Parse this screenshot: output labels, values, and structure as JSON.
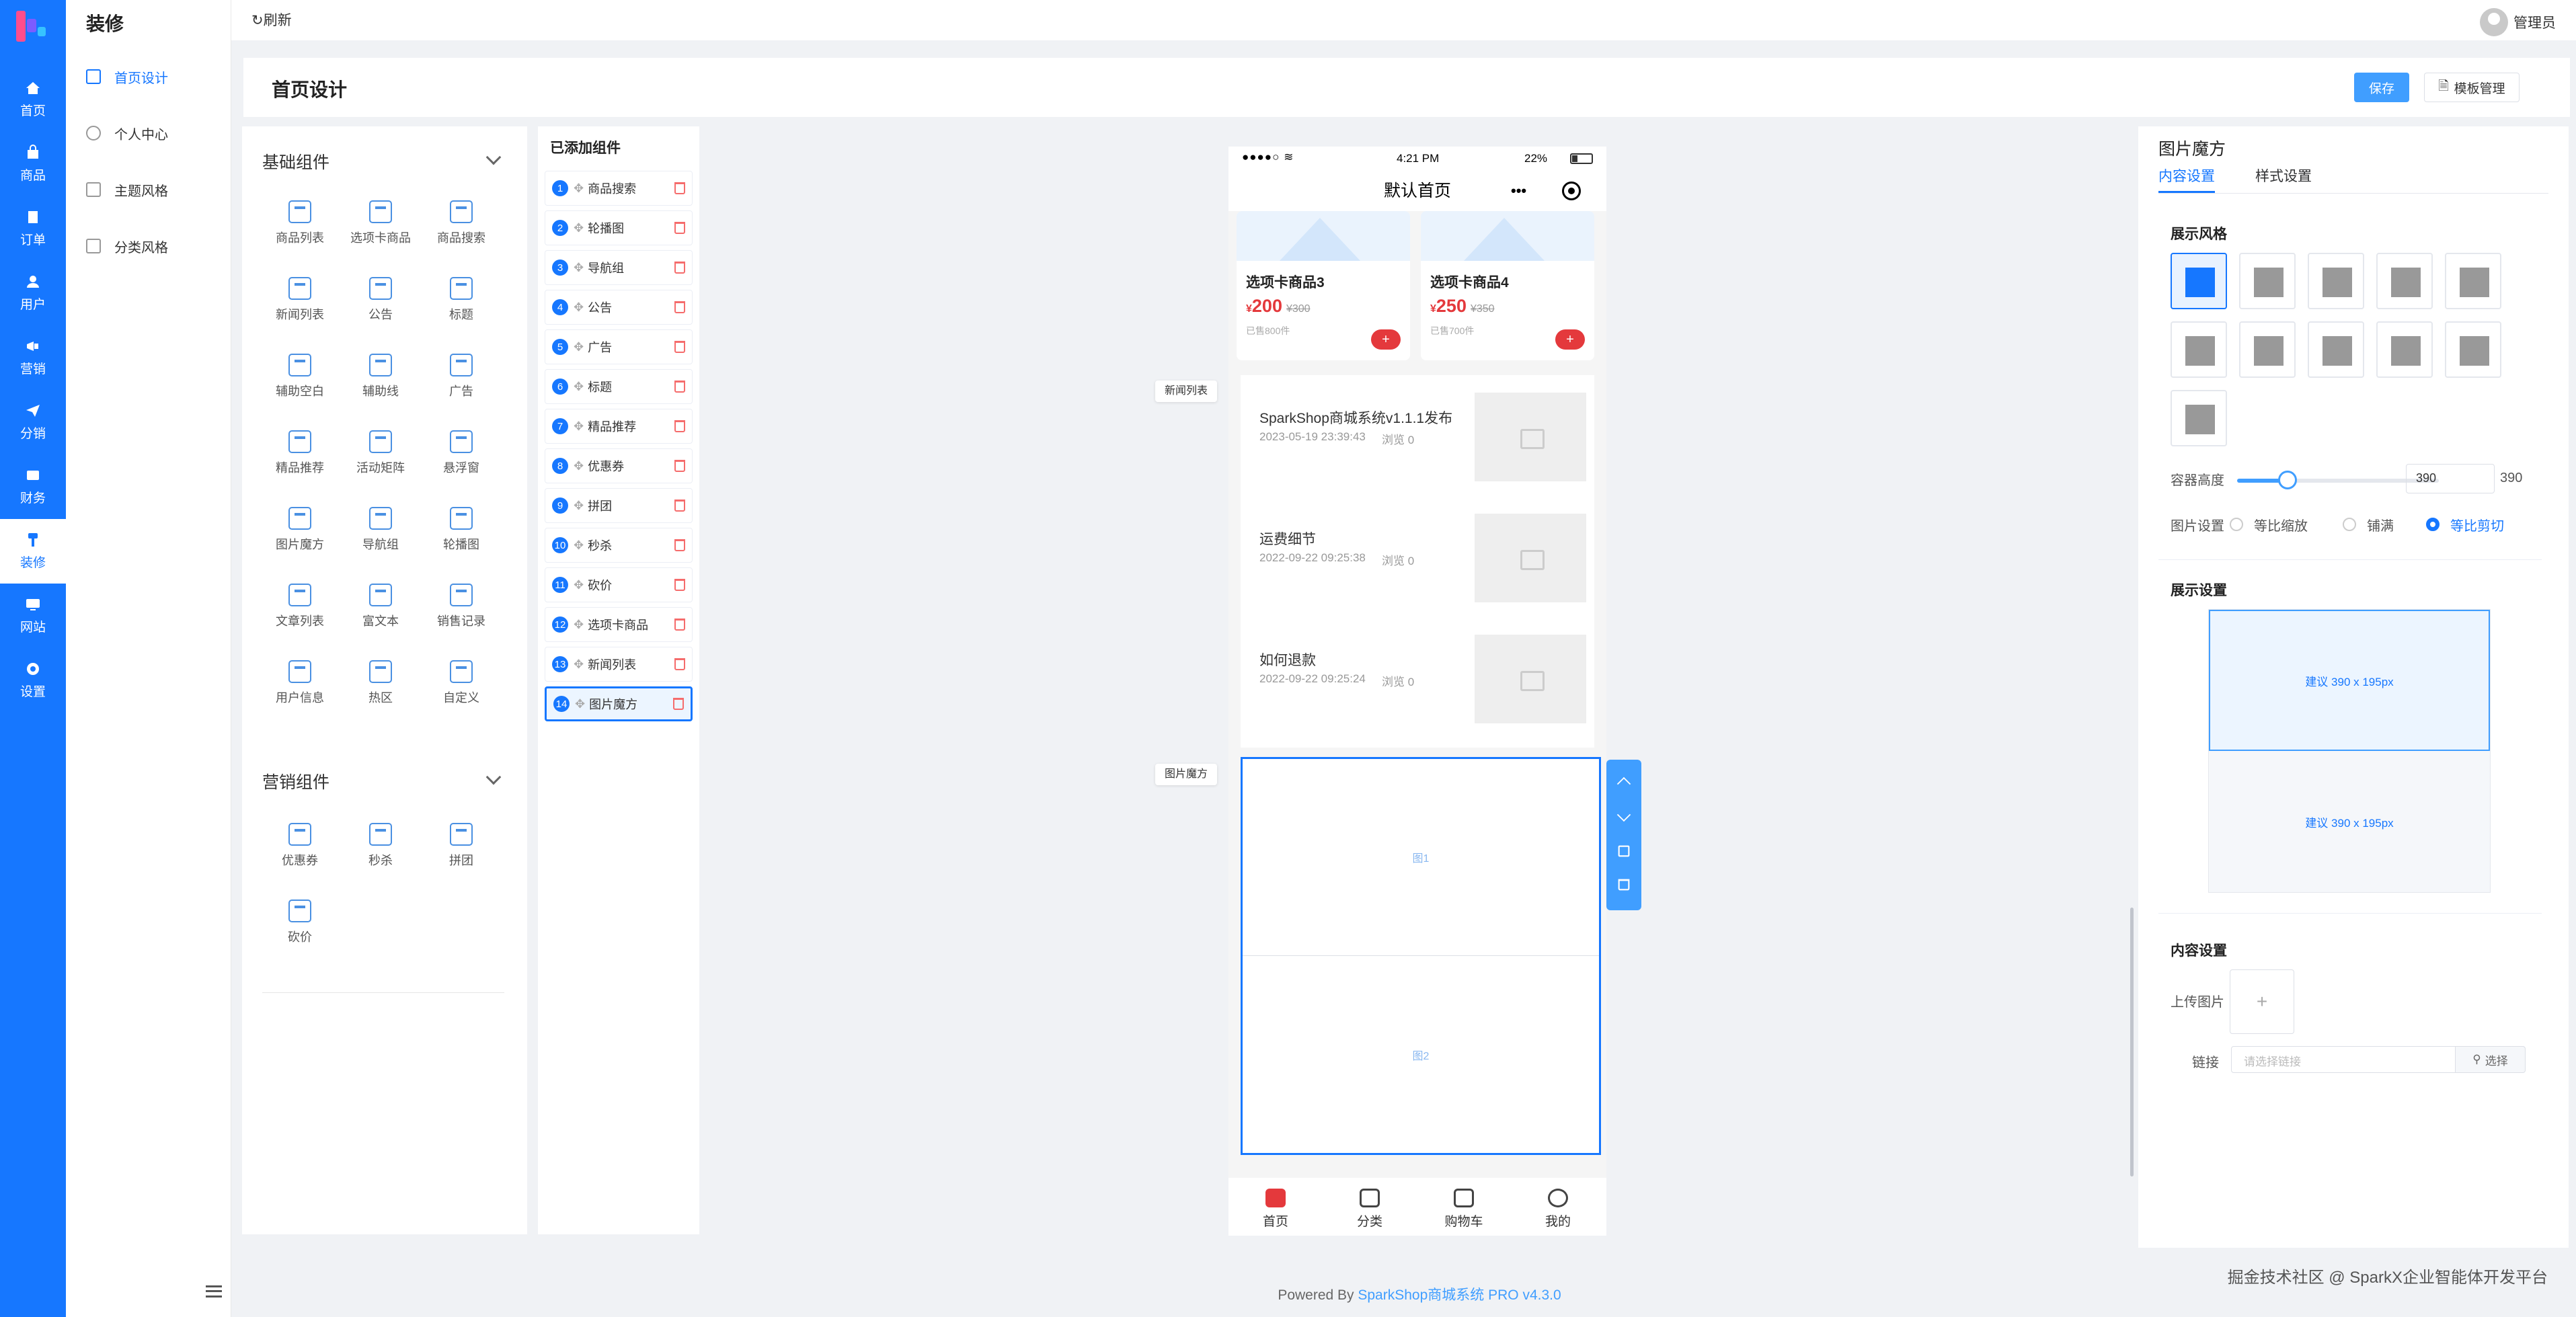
{
  "nav": {
    "items": [
      {
        "label": "首页",
        "icon": "home-icon"
      },
      {
        "label": "商品",
        "icon": "bag-icon"
      },
      {
        "label": "订单",
        "icon": "order-icon"
      },
      {
        "label": "用户",
        "icon": "user-icon"
      },
      {
        "label": "营销",
        "icon": "megaphone-icon"
      },
      {
        "label": "分销",
        "icon": "send-icon"
      },
      {
        "label": "财务",
        "icon": "finance-icon"
      },
      {
        "label": "装修",
        "icon": "brush-icon"
      },
      {
        "label": "网站",
        "icon": "monitor-icon"
      },
      {
        "label": "设置",
        "icon": "gear-icon"
      }
    ],
    "active": "装修"
  },
  "subnav": {
    "title": "装修",
    "items": [
      "首页设计",
      "个人中心",
      "主题风格",
      "分类风格"
    ]
  },
  "topbar": {
    "refresh": "刷新",
    "admin": "管理员"
  },
  "header": {
    "title": "首页设计",
    "save": "保存",
    "template": "模板管理"
  },
  "library": {
    "basic_title": "基础组件",
    "basic": [
      "商品列表",
      "选项卡商品",
      "商品搜索",
      "新闻列表",
      "公告",
      "标题",
      "辅助空白",
      "辅助线",
      "广告",
      "精品推荐",
      "活动矩阵",
      "悬浮窗",
      "图片魔方",
      "导航组",
      "轮播图",
      "文章列表",
      "富文本",
      "销售记录",
      "用户信息",
      "热区",
      "自定义"
    ],
    "marketing_title": "营销组件",
    "marketing": [
      "优惠券",
      "秒杀",
      "拼团",
      "砍价"
    ]
  },
  "added": {
    "title": "已添加组件",
    "items": [
      "商品搜索",
      "轮播图",
      "导航组",
      "公告",
      "广告",
      "标题",
      "精品推荐",
      "优惠券",
      "拼团",
      "秒杀",
      "砍价",
      "选项卡商品",
      "新闻列表",
      "图片魔方"
    ],
    "numbers": [
      "1",
      "2",
      "3",
      "4",
      "5",
      "6",
      "7",
      "8",
      "9",
      "10",
      "11",
      "12",
      "13",
      "14"
    ],
    "active_index": 13
  },
  "phone": {
    "time": "4:21 PM",
    "battery": "22%",
    "title": "默认首页",
    "products": [
      {
        "name": "选项卡商品3",
        "price": "200",
        "old_price": "¥300",
        "sold": "已售800件"
      },
      {
        "name": "选项卡商品4",
        "price": "250",
        "old_price": "¥350",
        "sold": "已售700件"
      }
    ],
    "plus": "+",
    "currency": "¥",
    "news": [
      {
        "title": "SparkShop商城系统v1.1.1发布",
        "date": "2023-05-19 23:39:43",
        "views": "浏览 0"
      },
      {
        "title": "运费细节",
        "date": "2022-09-22 09:25:38",
        "views": "浏览 0"
      },
      {
        "title": "如何退款",
        "date": "2022-09-22 09:25:24",
        "views": "浏览 0"
      }
    ],
    "magic_cells": [
      "图1",
      "图2"
    ],
    "tabs": [
      "首页",
      "分类",
      "购物车",
      "我的"
    ],
    "tag_news": "新闻列表",
    "tag_magic": "图片魔方"
  },
  "panel": {
    "title": "图片魔方",
    "tabs": [
      "内容设置",
      "样式设置"
    ],
    "style_section": "展示风格",
    "height_label": "容器高度",
    "height_value": "390",
    "height_max": "390",
    "height_fraction": 0.25,
    "image_setting_label": "图片设置",
    "image_options": [
      "等比缩放",
      "铺满",
      "等比剪切"
    ],
    "display_section": "展示设置",
    "suggest": [
      "建议 390 x 195px",
      "建议 390 x 195px"
    ],
    "content_section": "内容设置",
    "upload_label": "上传图片",
    "upload_plus": "+",
    "link_label": "链接",
    "link_placeholder": "请选择链接",
    "link_button": "选择"
  },
  "footer": {
    "prefix": "Powered By ",
    "brand": "SparkShop商城系统 PRO v4.3.0"
  },
  "watermark": "掘金技术社区 @ SparkX企业智能体开发平台"
}
